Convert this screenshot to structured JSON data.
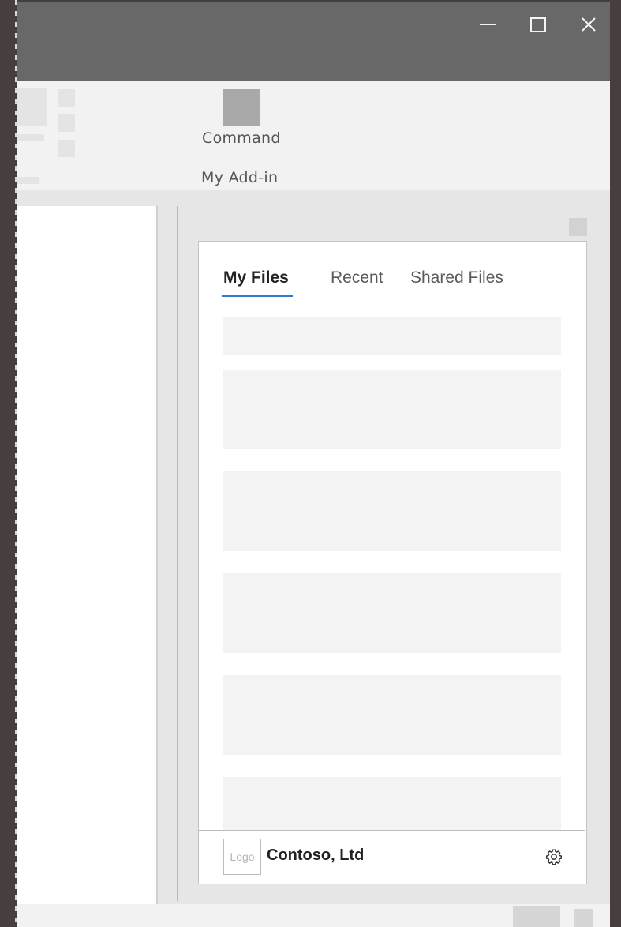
{
  "window": {
    "minimize_icon": "minimize-icon",
    "maximize_icon": "maximize-icon",
    "close_icon": "close-icon"
  },
  "ribbon": {
    "command_label": "Command",
    "group_label": "My Add-in"
  },
  "taskpane": {
    "tabs": [
      {
        "label": "My Files",
        "selected": true
      },
      {
        "label": "Recent",
        "selected": false
      },
      {
        "label": "Shared Files",
        "selected": false
      }
    ],
    "footer": {
      "logo_text": "Logo",
      "company": "Contoso, Ltd",
      "settings_icon": "gear-icon"
    }
  },
  "colors": {
    "titlebar": "#686868",
    "accent": "#2b7cd3",
    "ribbon": "#f2f2f2",
    "placeholder": "#f3f3f3"
  }
}
